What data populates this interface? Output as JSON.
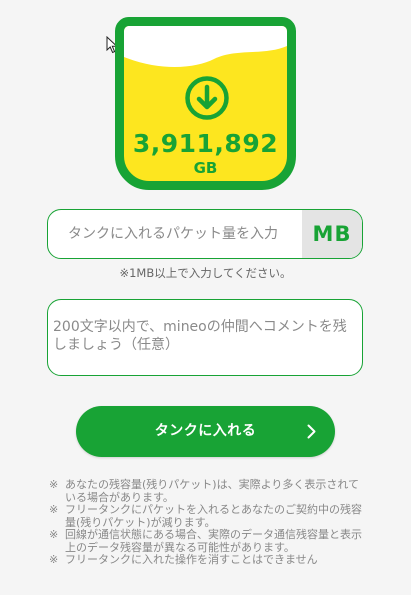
{
  "colors": {
    "brand_green": "#18a335",
    "tank_fill_yellow": "#fde61f",
    "background": "#f5f5f5"
  },
  "tank": {
    "icon": "download-arrow-icon",
    "value": "3,911,892",
    "unit": "GB"
  },
  "packet_input": {
    "placeholder": "タンクに入れるパケット量を入力",
    "value": "",
    "unit_label": "MB",
    "note": "※1MB以上で入力してください。"
  },
  "comment": {
    "placeholder": "200文字以内で、mineoの仲間へコメントを残しましょう（任意）",
    "value": ""
  },
  "submit": {
    "label": "タンクに入れる",
    "icon": "chevron-right-icon"
  },
  "notes": {
    "mark": "※",
    "items": [
      "あなたの残容量(残りパケット)は、実際より多く表示されている場合があります。",
      "フリータンクにパケットを入れるとあなたのご契約中の残容量(残りパケット)が減ります。",
      "回線が通信状態にある場合、実際のデータ通信残容量と表示上のデータ残容量が異なる可能性があります。",
      "フリータンクに入れた操作を消すことはできません"
    ]
  }
}
